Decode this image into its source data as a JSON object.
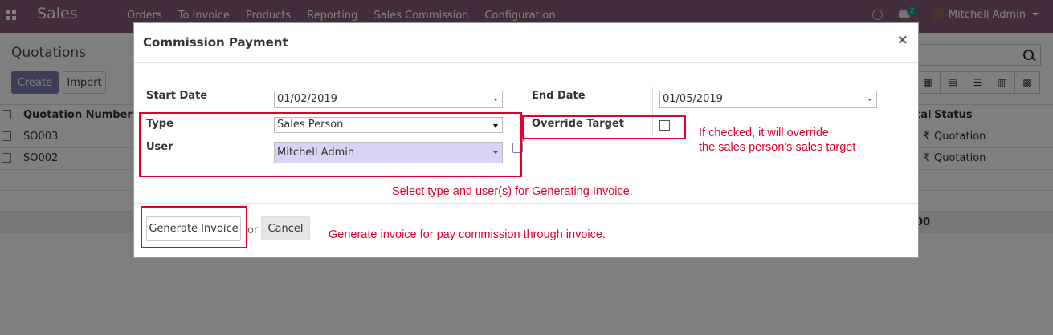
{
  "navbar": {
    "app_name": "Sales",
    "menu": [
      "Orders",
      "To Invoice",
      "Products",
      "Reporting",
      "Sales Commission",
      "Configuration"
    ],
    "chat_count": "2",
    "user_name": "Mitchell Admin"
  },
  "control_panel": {
    "breadcrumb": "Quotations",
    "create_label": "Create",
    "import_label": "Import"
  },
  "list": {
    "headers": {
      "number": "Quotation Number",
      "total": "tal",
      "status": "Status"
    },
    "rows": [
      {
        "number": "SO003",
        "total": "₹",
        "status": "Quotation"
      },
      {
        "number": "SO002",
        "total": "₹",
        "status": "Quotation"
      }
    ],
    "footer_total": "00"
  },
  "modal": {
    "title": "Commission Payment",
    "close_glyph": "×",
    "start_date_label": "Start Date",
    "start_date_value": "01/02/2019",
    "end_date_label": "End Date",
    "end_date_value": "01/05/2019",
    "type_label": "Type",
    "type_value": "Sales Person",
    "user_label": "User",
    "user_value": "Mitchell Admin",
    "override_label": "Override Target",
    "override_checked": false,
    "generate_label": "Generate Invoice",
    "or_text": "or",
    "cancel_label": "Cancel"
  },
  "annotations": {
    "override_note_1": "If checked, it will override",
    "override_note_2": "the sales person's sales target",
    "type_user_note": "Select type and user(s) for Generating Invoice.",
    "generate_note": "Generate invoice for pay commission through invoice."
  },
  "colors": {
    "navbar": "#875a7b",
    "primary": "#7c7bad",
    "annotation": "#e4002b"
  }
}
